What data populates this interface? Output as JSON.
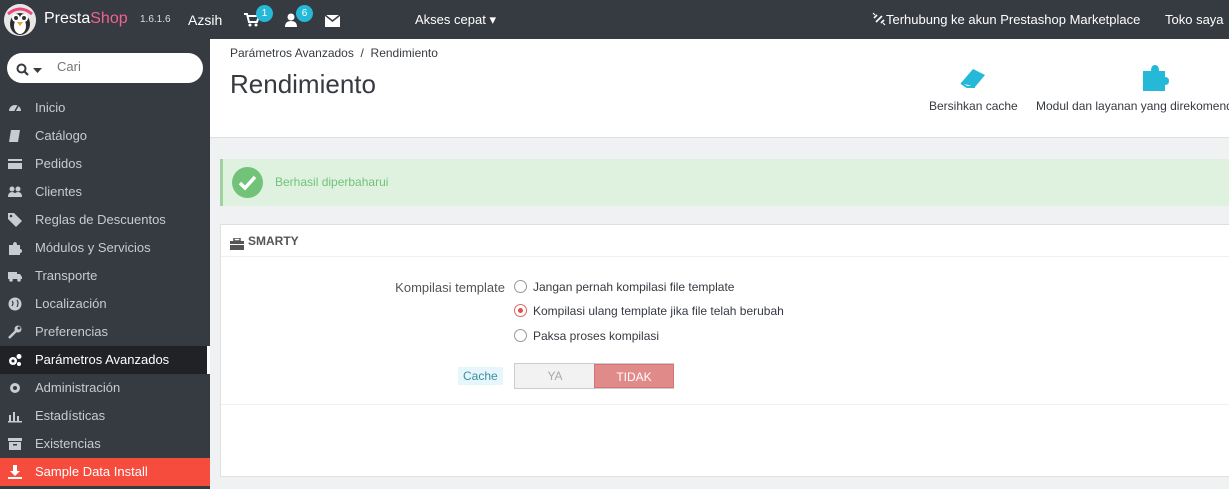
{
  "topbar": {
    "brand_presta": "Presta",
    "brand_shop": "Shop",
    "version": "1.6.1.6",
    "user": "Azsih",
    "cart_badge": "1",
    "customers_badge": "6",
    "quick_access": "Akses cepat",
    "marketplace": "Terhubung ke akun Prestashop Marketplace",
    "shop_link": "Toko saya"
  },
  "search": {
    "placeholder": "Cari"
  },
  "sidebar": {
    "items": [
      {
        "label": "Inicio",
        "icon": "dashboard-icon"
      },
      {
        "label": "Catálogo",
        "icon": "book-icon"
      },
      {
        "label": "Pedidos",
        "icon": "credit-card-icon"
      },
      {
        "label": "Clientes",
        "icon": "users-icon"
      },
      {
        "label": "Reglas de Descuentos",
        "icon": "tag-icon"
      },
      {
        "label": "Módulos y Servicios",
        "icon": "puzzle-icon"
      },
      {
        "label": "Transporte",
        "icon": "truck-icon"
      },
      {
        "label": "Localización",
        "icon": "globe-icon"
      },
      {
        "label": "Preferencias",
        "icon": "wrench-icon"
      },
      {
        "label": "Parámetros Avanzados",
        "icon": "cogs-icon"
      },
      {
        "label": "Administración",
        "icon": "cog-icon"
      },
      {
        "label": "Estadísticas",
        "icon": "bar-chart-icon"
      },
      {
        "label": "Existencias",
        "icon": "archive-icon"
      },
      {
        "label": "Sample Data Install",
        "icon": "download-icon"
      }
    ]
  },
  "header": {
    "breadcrumb_parent": "Parámetros Avanzados",
    "breadcrumb_sep": "/",
    "breadcrumb_current": "Rendimiento",
    "title": "Rendimiento",
    "toolbar_clear": "Bersihkan cache",
    "toolbar_modules": "Modul dan layanan yang direkomendasikan"
  },
  "alert": {
    "text": "Berhasil diperbaharui"
  },
  "panel": {
    "title": "SMARTY",
    "compile_label": "Kompilasi template",
    "options": [
      {
        "label": "Jangan pernah kompilasi file template",
        "checked": false
      },
      {
        "label": "Kompilasi ulang template jika file telah berubah",
        "checked": true
      },
      {
        "label": "Paksa proses kompilasi",
        "checked": false
      }
    ],
    "cache_label": "Cache",
    "switch_yes": "YA",
    "switch_no": "TIDAK",
    "cache_enabled": false
  },
  "colors": {
    "topbar": "#363a41",
    "accent_pink": "#f06292",
    "badge": "#25b9d7",
    "sample_item": "#f54c3e",
    "success": "#72c279"
  }
}
